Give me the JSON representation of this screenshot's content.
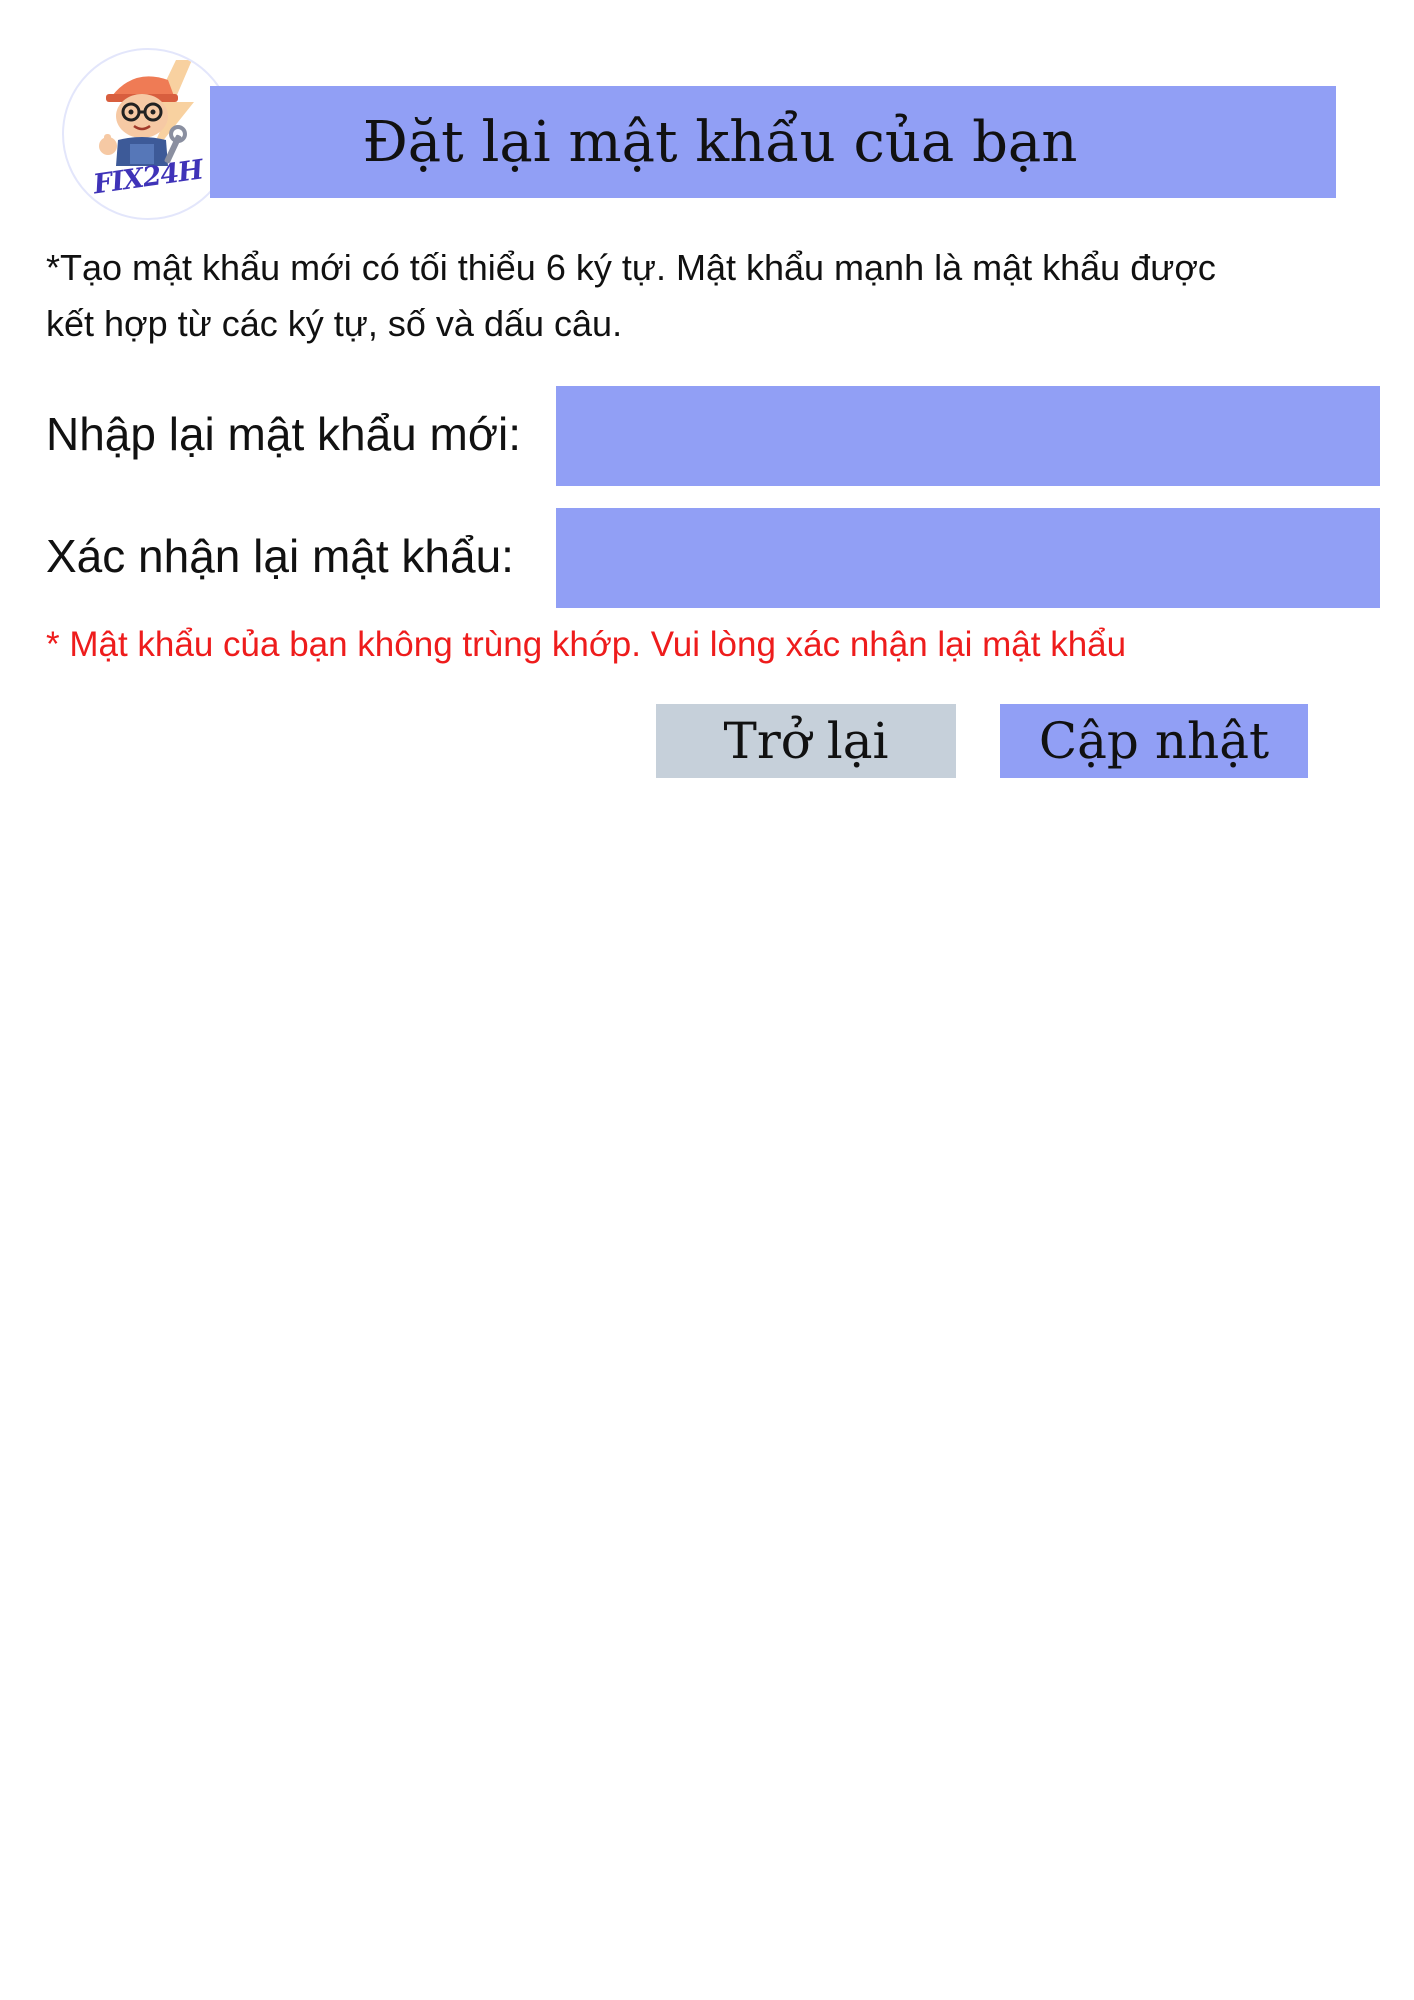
{
  "colors": {
    "accent": "#919ff5",
    "back_button_bg": "#c6d0da",
    "error_text": "#ee1c1c",
    "logo_text": "#3f33b8"
  },
  "logo": {
    "text": "FIX24H",
    "icon": "mechanic-mascot-icon"
  },
  "header": {
    "title": "Đặt lại mật khẩu của bạn"
  },
  "instruction": {
    "line1": "*Tạo mật khẩu mới có tối thiểu 6 ký tự. Mật khẩu mạnh là mật khẩu được",
    "line2": "kết hợp từ các ký tự, số và dấu câu."
  },
  "form": {
    "new_password": {
      "label": "Nhập lại mật khẩu mới:",
      "value": ""
    },
    "confirm_password": {
      "label": "Xác nhận lại mật khẩu:",
      "value": ""
    },
    "error": "* Mật khẩu của bạn không trùng khớp. Vui lòng xác nhận lại mật khẩu"
  },
  "buttons": {
    "back_label": "Trở lại",
    "update_label": "Cập nhật"
  }
}
